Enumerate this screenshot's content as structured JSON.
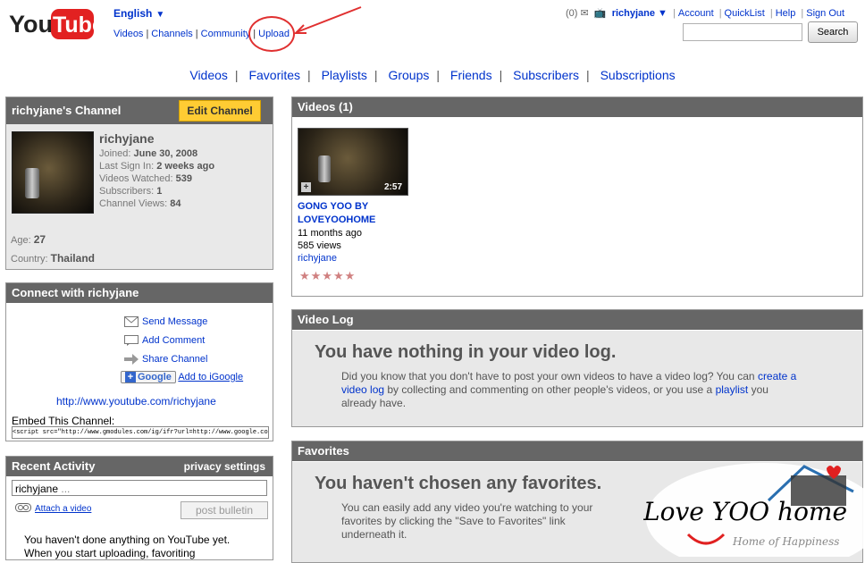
{
  "header": {
    "logo_text": "YouTube",
    "language": "English",
    "topnav": [
      "Videos",
      "Channels",
      "Community",
      "Upload"
    ],
    "notif_count": "(0)",
    "username": "richyjane",
    "util_links": [
      "Account",
      "QuickList",
      "Help",
      "Sign Out"
    ],
    "search_button": "Search",
    "search_value": ""
  },
  "channel_nav": [
    "Videos",
    "Favorites",
    "Playlists",
    "Groups",
    "Friends",
    "Subscribers",
    "Subscriptions"
  ],
  "channel": {
    "title": "richyjane's Channel",
    "edit_button": "Edit Channel",
    "name": "richyjane",
    "stats": [
      {
        "label": "Joined:",
        "value": "June 30, 2008"
      },
      {
        "label": "Last Sign In:",
        "value": "2 weeks ago"
      },
      {
        "label": "Videos Watched:",
        "value": "539"
      },
      {
        "label": "Subscribers:",
        "value": "1"
      },
      {
        "label": "Channel Views:",
        "value": "84"
      }
    ],
    "age_label": "Age:",
    "age_value": "27",
    "country_label": "Country:",
    "country_value": "Thailand"
  },
  "connect": {
    "title": "Connect with richyjane",
    "send_message": "Send Message",
    "add_comment": "Add Comment",
    "share_channel": "Share Channel",
    "google_label": "Google",
    "add_igoogle": "Add to iGoogle",
    "channel_url": "http://www.youtube.com/richyjane",
    "embed_label": "Embed This Channel:",
    "embed_code": "<script src=\"http://www.gmodules.com/ig/ifr?url=http://www.google.com/ig/modules/"
  },
  "recent": {
    "title": "Recent Activity",
    "privacy": "privacy settings",
    "bulletin_user": "richyjane",
    "bulletin_placeholder": "...",
    "attach": "Attach a video",
    "post_button": "post bulletin",
    "message_line1": "You haven't done anything on YouTube yet.",
    "message_line2": "When you start uploading, favoriting"
  },
  "videos": {
    "title": "Videos (1)",
    "items": [
      {
        "title": "GONG YOO BY LOVEYOOHOME",
        "duration": "2:57",
        "age": "11 months ago",
        "views": "585 views",
        "author": "richyjane",
        "rating": 5,
        "stars_text": "★★★★★"
      }
    ]
  },
  "video_log": {
    "title": "Video Log",
    "heading": "You have nothing in your video log.",
    "text_a": "Did you know that you don't have to post your own videos to have a video log? You can ",
    "link_a": "create a video log",
    "text_b": " by collecting and commenting on other people's videos, or you use a ",
    "link_b": "playlist",
    "text_c": " you already have."
  },
  "favorites": {
    "title": "Favorites",
    "heading": "You haven't chosen any favorites.",
    "text_a": "You can easily add any video you're watching to your favorites by clicking the \"Save to Favorites\" link underneath it.",
    "save_link": "Save to Favorites"
  },
  "watermark": {
    "text": "Love YOO home",
    "subtext": "Home of Happiness"
  },
  "colors": {
    "header_bar": "#666666",
    "link": "#0033cc",
    "edit_button": "#ffcc33",
    "annotation": "#e03030",
    "panel_bg": "#e8e8e8"
  }
}
